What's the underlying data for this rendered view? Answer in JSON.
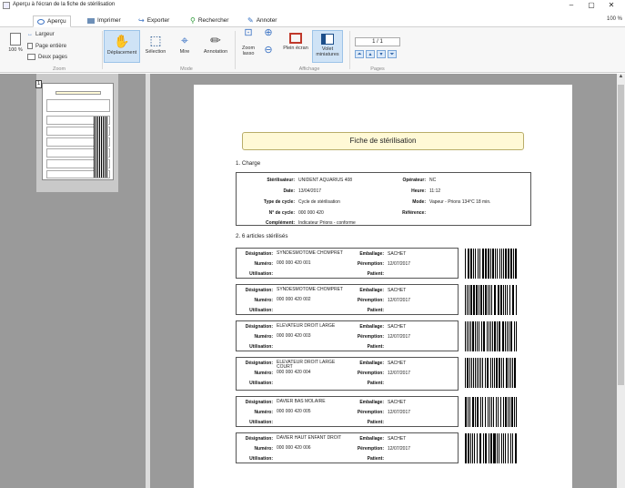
{
  "window": {
    "title": "Aperçu à l'écran de la fiche de stérilisation",
    "zoom_label": "100 %",
    "min": "–",
    "max": "▢",
    "close": "✕"
  },
  "menu": [
    {
      "label": "Aperçu",
      "icon": "preview-icon"
    },
    {
      "label": "Imprimer",
      "icon": "printer-icon"
    },
    {
      "label": "Exporter",
      "icon": "export-icon"
    },
    {
      "label": "Rechercher",
      "icon": "search-icon"
    },
    {
      "label": "Annoter",
      "icon": "annotate-icon"
    }
  ],
  "ribbon": {
    "zoom_pct": "100 %",
    "largeur": "Largeur",
    "page_entiere": "Page entière",
    "deux_pages": "Deux pages",
    "deplacement": "Déplacement",
    "selection": "Sélection",
    "mire": "Mire",
    "annotation": "Annotation",
    "zoom_lasso": "Zoom lasso",
    "plein_ecran": "Plein écran",
    "volet_miniatures": "Volet miniatures",
    "page_counter": "1 / 1",
    "groups": [
      "Zoom",
      "Mode",
      "Affichage",
      "Pages"
    ]
  },
  "thumbnail": {
    "page_number": "1"
  },
  "document": {
    "title": "Fiche de stérilisation",
    "section1": "1. Charge",
    "section2": "2. 6 articles stérilisés",
    "charge": {
      "sterilisateur_label": "Stérilisateur:",
      "sterilisateur": "UNIDENT AQUARIUS 408",
      "date_label": "Date:",
      "date": "13/04/2017",
      "type_label": "Type de cycle:",
      "type": "Cycle de stérilisation",
      "cycle_label": "N° de cycle:",
      "cycle": "000 000 420",
      "complement_label": "Complément:",
      "complement": "Indicateur Prions - conforme",
      "operateur_label": "Opérateur:",
      "operateur": "NC",
      "heure_label": "Heure:",
      "heure": "11:12",
      "mode_label": "Mode:",
      "mode": "Vapeur - Prions 134°C 18 min.",
      "reference_label": "Référence:",
      "reference": ""
    },
    "labels": {
      "designation": "Désignation:",
      "numero": "Numéro:",
      "utilisation": "Utilisation:",
      "emballage": "Emballage:",
      "peremption": "Péremption:",
      "patient": "Patient:"
    },
    "articles": [
      {
        "designation": "SYNDESMOTOME CHOMPRET",
        "numero": "000 000 420 001",
        "emballage": "SACHET",
        "peremption": "12/07/2017"
      },
      {
        "designation": "SYNDESMOTOME CHOMPRET",
        "numero": "000 000 420 002",
        "emballage": "SACHET",
        "peremption": "12/07/2017"
      },
      {
        "designation": "ELEVATEUR DROIT LARGE",
        "numero": "000 000 420 003",
        "emballage": "SACHET",
        "peremption": "12/07/2017"
      },
      {
        "designation": "ELEVATEUR DROIT LARGE COURT",
        "numero": "000 000 420 004",
        "emballage": "SACHET",
        "peremption": "12/07/2017"
      },
      {
        "designation": "DAVIER BAS MOLAIRE",
        "numero": "000 000 420 005",
        "emballage": "SACHET",
        "peremption": "12/07/2017"
      },
      {
        "designation": "DAVIER HAUT ENFANT DROIT",
        "numero": "000 000 420 006",
        "emballage": "SACHET",
        "peremption": "12/07/2017"
      }
    ]
  }
}
